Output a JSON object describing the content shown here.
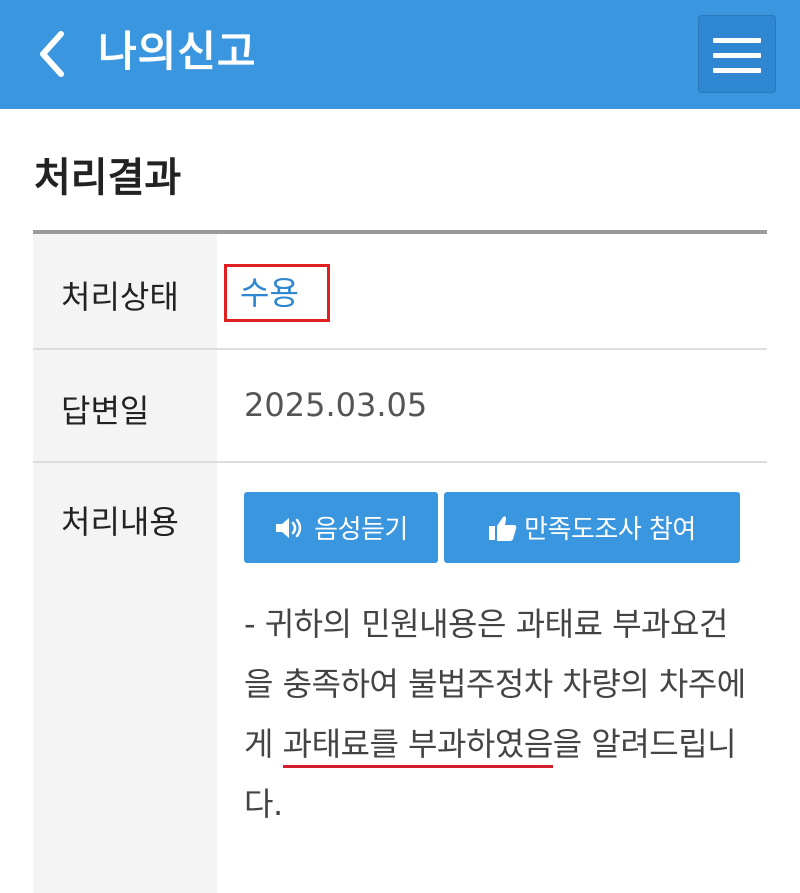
{
  "header": {
    "title": "나의신고",
    "back_icon": "chevron-left-icon",
    "menu_icon": "hamburger-menu-icon",
    "background_color": "#3a96de"
  },
  "section": {
    "title": "처리결과"
  },
  "rows": {
    "status": {
      "label": "처리상태",
      "value": "수용",
      "highlight_color": "#e02020",
      "value_color": "#2f86d1"
    },
    "answer_date": {
      "label": "답변일",
      "value": "2025.03.05"
    },
    "content": {
      "label": "처리내용",
      "listen_button": {
        "label": "음성듣기",
        "icon": "speaker-icon"
      },
      "survey_button": {
        "label": "만족도조사 참여",
        "icon": "thumbs-up-icon"
      },
      "text_before": "- 귀하의 민원내용은 과태료 부과요건을 충족하여 불법주정차 차량의 차주에게 ",
      "text_underlined": "과태료를 부과하였음",
      "text_after": "을 알려드립니다.",
      "underline_color": "#d21f2e"
    }
  }
}
